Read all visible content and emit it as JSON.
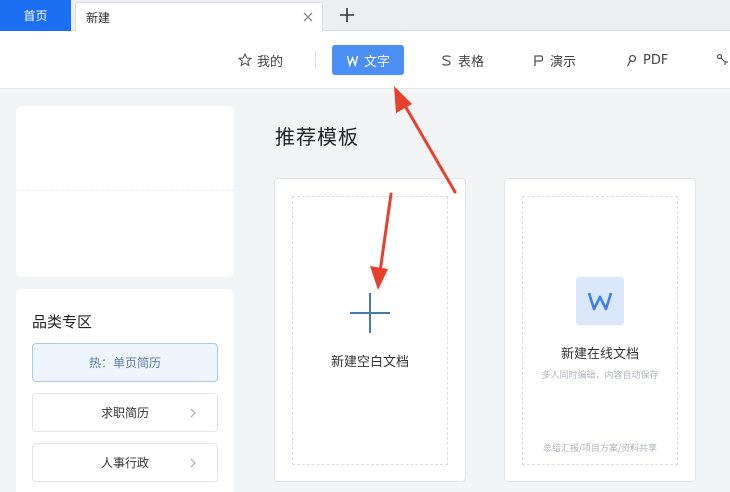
{
  "tabs": {
    "home": "首页",
    "new_tab": "新建"
  },
  "nav": {
    "mine": "我的",
    "writer": "文字",
    "sheet": "表格",
    "present": "演示",
    "pdf": "PDF"
  },
  "sidebar": {
    "category_title": "品类专区",
    "items": [
      {
        "label": "热：单页简历"
      },
      {
        "label": "求职简历"
      },
      {
        "label": "人事行政"
      }
    ]
  },
  "main": {
    "section_title": "推荐模板",
    "blank_card": {
      "label": "新建空白文档"
    },
    "online_card": {
      "label": "新建在线文档",
      "subtitle": "多人同时编辑，内容自动保存",
      "footer": "总结汇报/项目方案/资料共享"
    }
  },
  "colors": {
    "accent": "#4b8ff5",
    "home_tab": "#1d6ff2",
    "annotation": "#e8402e"
  }
}
